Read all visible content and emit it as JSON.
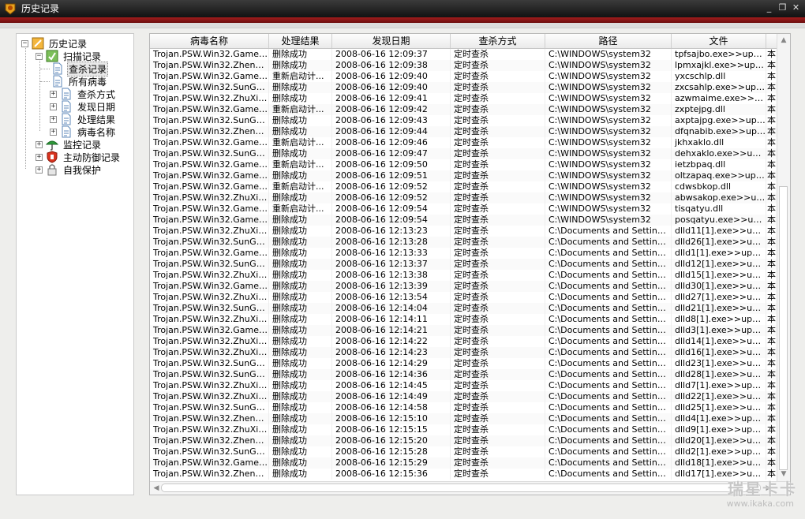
{
  "window": {
    "title": "历史记录",
    "minimize_glyph": "_",
    "maximize_glyph": "❐",
    "close_glyph": "✕"
  },
  "tree": {
    "root": {
      "label": "历史记录",
      "expander": "−"
    },
    "scan": {
      "label": "扫描记录",
      "expander": "−"
    },
    "scan_children": [
      {
        "label": "查杀记录",
        "expander": "",
        "selected": true
      },
      {
        "label": "所有病毒",
        "expander": ""
      },
      {
        "label": "查杀方式",
        "expander": "+"
      },
      {
        "label": "发现日期",
        "expander": "+"
      },
      {
        "label": "处理结果",
        "expander": "+"
      },
      {
        "label": "病毒名称",
        "expander": "+"
      }
    ],
    "others": [
      {
        "label": "监控记录",
        "expander": "+",
        "icon": "umbrella-icon"
      },
      {
        "label": "主动防御记录",
        "expander": "+",
        "icon": "shield-icon"
      },
      {
        "label": "自我保护",
        "expander": "+",
        "icon": "lock-icon"
      }
    ]
  },
  "table": {
    "columns": [
      "病毒名称",
      "处理结果",
      "发现日期",
      "查杀方式",
      "路径",
      "文件",
      ""
    ],
    "rows": [
      [
        "Trojan.PSW.Win32.GameO...",
        "删除成功",
        "2008-06-16 12:09:37",
        "定时查杀",
        "C:\\WINDOWS\\system32",
        "tpfsajbo.exe>>upac...",
        "本"
      ],
      [
        "Trojan.PSW.Win32.ZhengT...",
        "删除成功",
        "2008-06-16 12:09:38",
        "定时查杀",
        "C:\\WINDOWS\\system32",
        "lpmxajkl.exe>>upack...",
        "本"
      ],
      [
        "Trojan.PSW.Win32.GameO...",
        "重新启动计...",
        "2008-06-16 12:09:40",
        "定时查杀",
        "C:\\WINDOWS\\system32",
        "yxcschlp.dll",
        "本"
      ],
      [
        "Trojan.PSW.Win32.SunGam...",
        "删除成功",
        "2008-06-16 12:09:40",
        "定时查杀",
        "C:\\WINDOWS\\system32",
        "zxcsahlp.exe>>upack...",
        "本"
      ],
      [
        "Trojan.PSW.Win32.ZhuXian...",
        "删除成功",
        "2008-06-16 12:09:41",
        "定时查杀",
        "C:\\WINDOWS\\system32",
        "azwmaime.exe>>up...",
        "本"
      ],
      [
        "Trojan.PSW.Win32.GameO...",
        "重新启动计...",
        "2008-06-16 12:09:42",
        "定时查杀",
        "C:\\WINDOWS\\system32",
        "zxptejpg.dll",
        "本"
      ],
      [
        "Trojan.PSW.Win32.SunGam...",
        "删除成功",
        "2008-06-16 12:09:43",
        "定时查杀",
        "C:\\WINDOWS\\system32",
        "axptajpg.exe>>upac...",
        "本"
      ],
      [
        "Trojan.PSW.Win32.ZhengT...",
        "删除成功",
        "2008-06-16 12:09:44",
        "定时查杀",
        "C:\\WINDOWS\\system32",
        "dfqnabib.exe>>upac...",
        "本"
      ],
      [
        "Trojan.PSW.Win32.GameO...",
        "重新启动计...",
        "2008-06-16 12:09:46",
        "定时查杀",
        "C:\\WINDOWS\\system32",
        "jkhxaklo.dll",
        "本"
      ],
      [
        "Trojan.PSW.Win32.SunGam...",
        "删除成功",
        "2008-06-16 12:09:47",
        "定时查杀",
        "C:\\WINDOWS\\system32",
        "dehxaklo.exe>>upac...",
        "本"
      ],
      [
        "Trojan.PSW.Win32.GameO...",
        "重新启动计...",
        "2008-06-16 12:09:50",
        "定时查杀",
        "C:\\WINDOWS\\system32",
        "ietzbpaq.dll",
        "本"
      ],
      [
        "Trojan.PSW.Win32.GameO...",
        "删除成功",
        "2008-06-16 12:09:51",
        "定时查杀",
        "C:\\WINDOWS\\system32",
        "oltzapaq.exe>>upac...",
        "本"
      ],
      [
        "Trojan.PSW.Win32.GameO...",
        "重新启动计...",
        "2008-06-16 12:09:52",
        "定时查杀",
        "C:\\WINDOWS\\system32",
        "cdwsbkop.dll",
        "本"
      ],
      [
        "Trojan.PSW.Win32.ZhuXian...",
        "删除成功",
        "2008-06-16 12:09:52",
        "定时查杀",
        "C:\\WINDOWS\\system32",
        "abwsakop.exe>>upa...",
        "本"
      ],
      [
        "Trojan.PSW.Win32.GameO...",
        "重新启动计...",
        "2008-06-16 12:09:54",
        "定时查杀",
        "C:\\WINDOWS\\system32",
        "tisqatyu.dll",
        "本"
      ],
      [
        "Trojan.PSW.Win32.GameO...",
        "删除成功",
        "2008-06-16 12:09:54",
        "定时查杀",
        "C:\\WINDOWS\\system32",
        "posqatyu.exe>>upac...",
        "本"
      ],
      [
        "Trojan.PSW.Win32.ZhuXian...",
        "删除成功",
        "2008-06-16 12:13:23",
        "定时查杀",
        "C:\\Documents and Settings\\u...",
        "dlld11[1].exe>>upac...",
        "本"
      ],
      [
        "Trojan.PSW.Win32.SunGam...",
        "删除成功",
        "2008-06-16 12:13:28",
        "定时查杀",
        "C:\\Documents and Settings\\u...",
        "dlld26[1].exe>>upac...",
        "本"
      ],
      [
        "Trojan.PSW.Win32.GameO...",
        "删除成功",
        "2008-06-16 12:13:33",
        "定时查杀",
        "C:\\Documents and Settings\\u...",
        "dlld1[1].exe>>upack...",
        "本"
      ],
      [
        "Trojan.PSW.Win32.SunGam...",
        "删除成功",
        "2008-06-16 12:13:37",
        "定时查杀",
        "C:\\Documents and Settings\\u...",
        "dlld12[1].exe>>upac...",
        "本"
      ],
      [
        "Trojan.PSW.Win32.ZhuXian...",
        "删除成功",
        "2008-06-16 12:13:38",
        "定时查杀",
        "C:\\Documents and Settings\\u...",
        "dlld15[1].exe>>upac...",
        "本"
      ],
      [
        "Trojan.PSW.Win32.GameO...",
        "删除成功",
        "2008-06-16 12:13:39",
        "定时查杀",
        "C:\\Documents and Settings\\u...",
        "dlld30[1].exe>>upac...",
        "本"
      ],
      [
        "Trojan.PSW.Win32.ZhuXian...",
        "删除成功",
        "2008-06-16 12:13:54",
        "定时查杀",
        "C:\\Documents and Settings\\u...",
        "dlld27[1].exe>>upac...",
        "本"
      ],
      [
        "Trojan.PSW.Win32.SunGam...",
        "删除成功",
        "2008-06-16 12:14:04",
        "定时查杀",
        "C:\\Documents and Settings\\u...",
        "dlld21[1].exe>>upac...",
        "本"
      ],
      [
        "Trojan.PSW.Win32.ZhuXian...",
        "删除成功",
        "2008-06-16 12:14:11",
        "定时查杀",
        "C:\\Documents and Settings\\u...",
        "dlld8[1].exe>>upack...",
        "本"
      ],
      [
        "Trojan.PSW.Win32.GameO...",
        "删除成功",
        "2008-06-16 12:14:21",
        "定时查杀",
        "C:\\Documents and Settings\\u...",
        "dlld3[1].exe>>upack...",
        "本"
      ],
      [
        "Trojan.PSW.Win32.ZhuXian...",
        "删除成功",
        "2008-06-16 12:14:22",
        "定时查杀",
        "C:\\Documents and Settings\\u...",
        "dlld14[1].exe>>upac...",
        "本"
      ],
      [
        "Trojan.PSW.Win32.ZhuXian...",
        "删除成功",
        "2008-06-16 12:14:23",
        "定时查杀",
        "C:\\Documents and Settings\\u...",
        "dlld16[1].exe>>upac...",
        "本"
      ],
      [
        "Trojan.PSW.Win32.SunGam...",
        "删除成功",
        "2008-06-16 12:14:29",
        "定时查杀",
        "C:\\Documents and Settings\\u...",
        "dlld23[1].exe>>upac...",
        "本"
      ],
      [
        "Trojan.PSW.Win32.SunGam...",
        "删除成功",
        "2008-06-16 12:14:36",
        "定时查杀",
        "C:\\Documents and Settings\\u...",
        "dlld28[1].exe>>upac...",
        "本"
      ],
      [
        "Trojan.PSW.Win32.ZhuXian...",
        "删除成功",
        "2008-06-16 12:14:45",
        "定时查杀",
        "C:\\Documents and Settings\\u...",
        "dlld7[1].exe>>upack...",
        "本"
      ],
      [
        "Trojan.PSW.Win32.ZhuXian...",
        "删除成功",
        "2008-06-16 12:14:49",
        "定时查杀",
        "C:\\Documents and Settings\\u...",
        "dlld22[1].exe>>upac...",
        "本"
      ],
      [
        "Trojan.PSW.Win32.SunGam...",
        "删除成功",
        "2008-06-16 12:14:58",
        "定时查杀",
        "C:\\Documents and Settings\\u...",
        "dlld25[1].exe>>upac...",
        "本"
      ],
      [
        "Trojan.PSW.Win32.ZhengT...",
        "删除成功",
        "2008-06-16 12:15:10",
        "定时查杀",
        "C:\\Documents and Settings\\u...",
        "dlld4[1].exe>>upack...",
        "本"
      ],
      [
        "Trojan.PSW.Win32.ZhuXian...",
        "删除成功",
        "2008-06-16 12:15:15",
        "定时查杀",
        "C:\\Documents and Settings\\u...",
        "dlld9[1].exe>>upack...",
        "本"
      ],
      [
        "Trojan.PSW.Win32.ZhengT...",
        "删除成功",
        "2008-06-16 12:15:20",
        "定时查杀",
        "C:\\Documents and Settings\\u...",
        "dlld20[1].exe>>upac...",
        "本"
      ],
      [
        "Trojan.PSW.Win32.SunGam...",
        "删除成功",
        "2008-06-16 12:15:28",
        "定时查杀",
        "C:\\Documents and Settings\\u...",
        "dlld2[1].exe>>upack...",
        "本"
      ],
      [
        "Trojan.PSW.Win32.GameO...",
        "删除成功",
        "2008-06-16 12:15:29",
        "定时查杀",
        "C:\\Documents and Settings\\u...",
        "dlld18[1].exe>>upac...",
        "本"
      ],
      [
        "Trojan.PSW.Win32.ZhengT...",
        "删除成功",
        "2008-06-16 12:15:36",
        "定时查杀",
        "C:\\Documents and Settings\\u...",
        "dlld17[1].exe>>upac...",
        "本"
      ]
    ]
  },
  "watermark": {
    "main": "瑞星卡卡",
    "sub": "www.ikaka.com"
  },
  "colors": {
    "title_bar": "#1e1e1e",
    "accent_red": "#8b1515",
    "selection": "#e8e8e8"
  }
}
